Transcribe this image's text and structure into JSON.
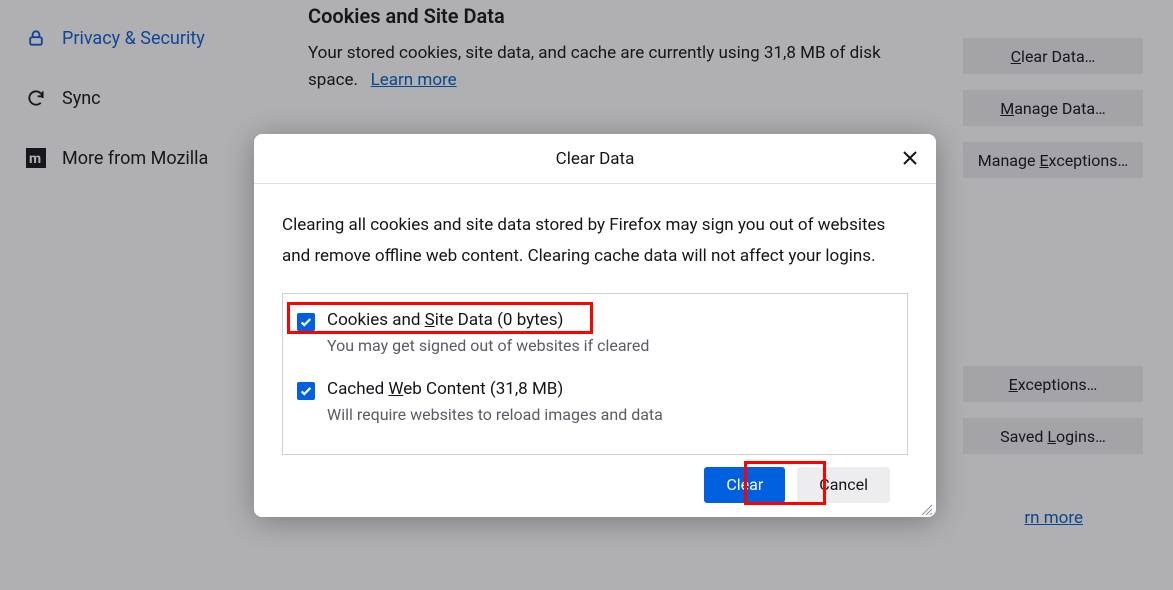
{
  "sidebar": {
    "privacy": "Privacy & Security",
    "sync": "Sync",
    "more": "More from Mozilla"
  },
  "section": {
    "title": "Cookies and Site Data",
    "desc_a": "Your stored cookies, site data, and cache are currently using 31,8 MB of disk space.",
    "learn": "Learn more"
  },
  "buttons": {
    "clear_data": "Clear Data…",
    "manage_data": "Manage Data…",
    "manage_exceptions": "Manage Exceptions…",
    "exceptions": "Exceptions…",
    "saved_logins": "Saved Logins…"
  },
  "learn2": "rn more",
  "dialog": {
    "title": "Clear Data",
    "text": "Clearing all cookies and site data stored by Firefox may sign you out of websites and remove offline web content. Clearing cache data will not affect your logins.",
    "opt1_a": "Cookies and ",
    "opt1_b": "S",
    "opt1_c": "ite Data (0 bytes)",
    "opt1_sub": "You may get signed out of websites if cleared",
    "opt2_a": "Cached ",
    "opt2_b": "W",
    "opt2_c": "eb Content (31,8 MB)",
    "opt2_sub": "Will require websites to reload images and data",
    "clear": "Clear",
    "cancel": "Cancel"
  },
  "mnemonic": {
    "clear_l": "C",
    "clear_r": "lear Data…",
    "manage_l": "M",
    "manage_r": "anage Data…",
    "mex_a": "Manage ",
    "mex_b": "E",
    "mex_c": "xceptions…",
    "ex_a": "E",
    "ex_b": "xceptions…",
    "sl_a": "Saved ",
    "sl_b": "L",
    "sl_c": "ogins…"
  }
}
